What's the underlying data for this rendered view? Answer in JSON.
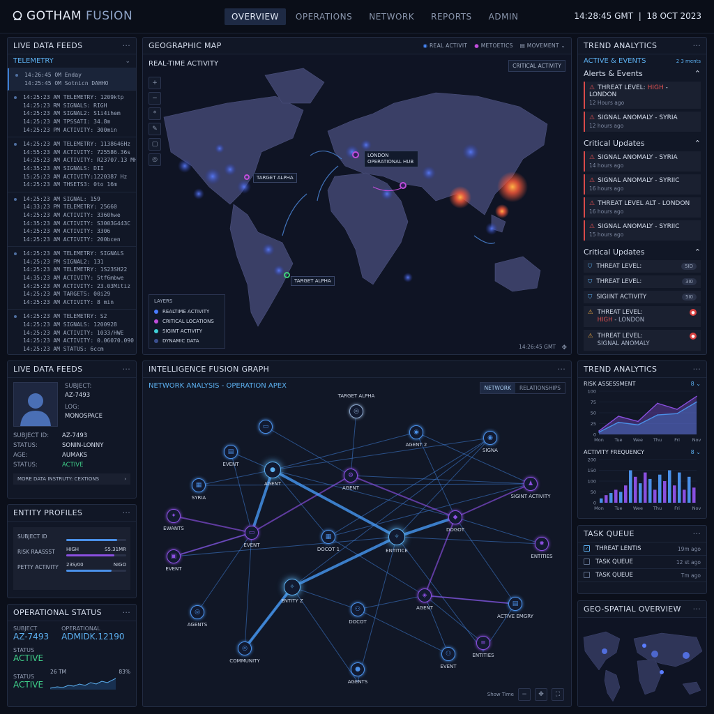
{
  "app": {
    "brand_a": "GOTHAM",
    "brand_b": "FUSION",
    "clock": "14:28:45 GMT",
    "date": "18 OCT 2023"
  },
  "nav": [
    "OVERVIEW",
    "OPERATIONS",
    "NETWORK",
    "REPORTS",
    "ADMIN"
  ],
  "feeds": {
    "title": "LIVE DATA FEEDS",
    "dropdown": "TELEMETRY",
    "blocks": [
      [
        "14:26:45 OM  Enday",
        "14:25:45 OM  Sotnicn DAHHO"
      ],
      [
        "14:25:23 AM  TELEMETRY: 1209ktp",
        "14:25:23 RM  SIGNALS: RIGH",
        "14:25:23 AM  SIGNAL2: S1i4ihem",
        "14:25:23 AM  TPSSATI: 34.8m",
        "14:25:23 PM  ACTIVITY: 300min"
      ],
      [
        "14:25:23 AM  TELEMETRY: 1138646Hz",
        "14:55:23 AM  ACTIVITY: 725586.36s",
        "14:25:23 AM  ACTIVITY: R23707.13 MHz",
        "14:35:23 AM  SIGNALS: DII",
        "15:25:23 AM  ACTIVITY:1220387 Hz",
        "14:25:23 AM  THSETS3: 0to 16m"
      ],
      [
        "14:25:23 AM  SIGNAL: 159",
        "14:33:23 PM  TELEMETRY: 25660",
        "14:25:23 AM  ACTIVITY: 3360hwe",
        "14:35:23 AM  ACTIVITY: S3003G443C",
        "14:25:23 AM  ACTIVITY: 3306",
        "14:25:23 AM  ACTIVITY: 200bcen"
      ],
      [
        "14:25:23 AM  TELEMETRY: SIGNALS",
        "14:25:23 PM  SIGNAL2: 131",
        "14:25:23 AM  TELEMETRY: 1S23SH22",
        "14:35:23 AM  ACTIVITY: 5tf6mbwe",
        "14:25:23 AM  ACTIVITY: 23.03Mitiz",
        "14:25:23 AM  TARGETS: 00i29",
        "14:25:23 AM  ACTIVITY: 8 min"
      ],
      [
        "14:25:23 AM  TELEMETRY: S2",
        "14:25:23 AM  SIGNALS: 1200928",
        "14:25:23 AM  ACTIVITY: 1033/HWE",
        "14:25:23 AM  ACTIVITY: 0.06070.090",
        "14:25:23 AM  STATUS: 6ccm"
      ]
    ]
  },
  "map": {
    "title": "GEOGRAPHIC MAP",
    "legend_top": [
      "REAL ACTIVIT",
      "METOETICS",
      "MOVEMENT"
    ],
    "realtime": "REAL-TIME ACTIVITY",
    "critical_btn": "CRITICAL ACTIVITY",
    "labels": {
      "london": "LONDON OPERATIONAL HUB",
      "target1": "TARGET ALPHA",
      "target2": "TARGET ALPHA"
    },
    "layers_title": "LAYERS",
    "layers": [
      "REALTIME ACTIVITY",
      "CRITICAL LOCATIONS",
      "SIGINT ACTIVITY",
      "DYNAMIC DATA"
    ],
    "layer_colors": [
      "#4a7cff",
      "#c04ddb",
      "#3fd0d8",
      "#3b4f8f"
    ],
    "timestamp": "14:26:45 GMT"
  },
  "trend": {
    "title": "TREND ANALYTICS",
    "sub": "ACTIVE & EVENTS",
    "sub_right": "2 3 ments",
    "alerts_title": "Alerts & Events",
    "alerts": [
      {
        "pre": "THREAT LEVEL: ",
        "hot": "HIGH",
        "post": " - LONDON",
        "time": "12 Hours ago"
      },
      {
        "pre": "SIGNAL ANOMALY - SYRIA",
        "hot": "",
        "post": "",
        "time": "12 hours ago"
      }
    ],
    "crit1_title": "Critical Updates",
    "crit1": [
      {
        "t": "SIGNAL ANOMALY - SYRIA",
        "s": "14 hours ago"
      },
      {
        "t": "SIGNAL ANOMALY - SYRIIC",
        "s": "16 hours ago"
      },
      {
        "t": "THREAT LEVEL ALT - LONDON",
        "s": "16 hours ago"
      },
      {
        "t": "SIGNAL ANOMALY - SYRIIC",
        "s": "15 hours ago"
      }
    ],
    "crit2_title": "Critical Updates",
    "crit2": [
      {
        "t": "THREAT LEVEL:",
        "b": "5ID"
      },
      {
        "t": "THREAT LEVEL:",
        "b": "3I0"
      },
      {
        "t": "SIGIINT ACTIVITY",
        "b": "5I0"
      }
    ],
    "crit2_warn": [
      {
        "l1": "THREAT LEVEL:",
        "hot": "HIGH",
        "l2": " - LONDON"
      },
      {
        "l1": "THREAT LEVEL:",
        "hot": "",
        "l2": "SIGNAL ANOMALY"
      }
    ]
  },
  "profile": {
    "title": "LIVE DATA FEEDS",
    "subject_label": "SUBJECT:",
    "subject": "AZ-7493",
    "log_label": "LOG:",
    "log": "MONOSPACE",
    "fields": [
      [
        "SUBJECT ID:",
        "AZ-7493"
      ],
      [
        "STATUS:",
        "SONIN-LONNY"
      ],
      [
        "AGE:",
        "AUMAKS"
      ],
      [
        "STATUS:",
        "ACTIVE"
      ]
    ],
    "more": "MORE DATA  INSTRUTY: CEXTIONS"
  },
  "entity": {
    "title": "ENTITY PROFILES",
    "rows": [
      {
        "label": "SUBJECT ID",
        "a": "",
        "b": ""
      },
      {
        "label": "RISK RAASSST",
        "a": "HIGH",
        "b": "S5.31MR"
      },
      {
        "label": "PETTY ACTIVITY",
        "a": "23S/00",
        "b": "NIGO"
      }
    ]
  },
  "ops": {
    "title": "OPERATIONAL STATUS",
    "subject_label": "SUBJECT",
    "subject": "AZ-7493",
    "op_label": "OPERATIONAL",
    "op": "ADMIDK.12190",
    "status_label": "STATUS",
    "status": "ACTIVE",
    "status2_label": "STATUS",
    "status2": "ACTIVE",
    "spark_l": "26 TM",
    "spark_r": "83%"
  },
  "graph": {
    "title": "INTELLIGENCE FUSION GRAPH",
    "sub": "NETWORK ANALYSIS - OPERATION APEX",
    "tabs": [
      "NETWORK",
      "RELATIONSHIPS"
    ],
    "show_time": "Show Time"
  },
  "risk": {
    "title": "TREND ANALYTICS",
    "risk_label": "RISK ASSESSMENT",
    "freq_label": "ACTIVITY FREQUENCY",
    "menu": "8"
  },
  "chart_data": [
    {
      "type": "area",
      "title": "RISK ASSESSMENT",
      "categories": [
        "Mon",
        "Tue",
        "Wee",
        "Thu",
        "Fri",
        "Nov"
      ],
      "ylim": [
        0,
        100
      ],
      "yticks": [
        0,
        25,
        50,
        75,
        100
      ],
      "series": [
        {
          "values": [
            8,
            42,
            30,
            72,
            58,
            88
          ],
          "color": "#8a4fe0"
        },
        {
          "values": [
            5,
            28,
            22,
            45,
            48,
            75
          ],
          "color": "#4a90e8"
        }
      ]
    },
    {
      "type": "bar",
      "title": "ACTIVITY FREQUENCY",
      "categories": [
        "Mon",
        "Tue",
        "Wee",
        "Thu",
        "Fri",
        "Nov"
      ],
      "ylim": [
        0,
        200
      ],
      "yticks": [
        0,
        50,
        100,
        150,
        200
      ],
      "values": [
        20,
        35,
        45,
        60,
        50,
        80,
        150,
        120,
        90,
        140,
        110,
        60,
        130,
        100,
        150,
        80,
        140,
        60,
        120,
        70
      ]
    }
  ],
  "tasks": {
    "title": "TASK QUEUE",
    "items": [
      {
        "label": "THREAT LENTIS",
        "time": "19m ago",
        "checked": true
      },
      {
        "label": "TASK QUEUE",
        "time": "12 st ago",
        "checked": false
      },
      {
        "label": "TASK QUEUE",
        "time": "Tm ago",
        "checked": false
      }
    ]
  },
  "geo": {
    "title": "GEO-SPATIAL OVERVIEW"
  }
}
